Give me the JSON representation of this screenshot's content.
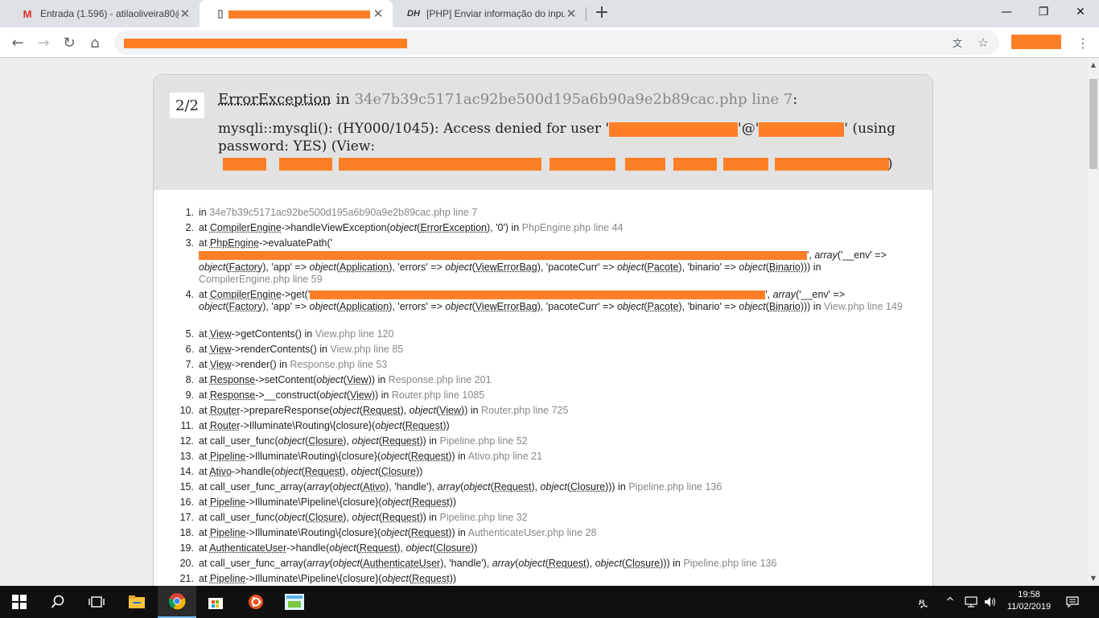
{
  "browser": {
    "tabs": [
      {
        "title": "Entrada (1.596) - atilaoliveira80@",
        "icon": "gmail-icon",
        "active": false
      },
      {
        "title": "",
        "icon": "page-icon",
        "active": true
      },
      {
        "title": "[PHP] Enviar informação do input",
        "icon": "dh-icon",
        "active": false
      }
    ],
    "new_tab_label": "+",
    "window_controls": {
      "minimize": "—",
      "maximize": "❐",
      "close": "✕"
    },
    "toolbar": {
      "back": "←",
      "forward": "→",
      "reload": "↻",
      "home": "⌂",
      "translate": "文",
      "bookmark": "☆"
    }
  },
  "error": {
    "count": "2/2",
    "exception": "ErrorException",
    "in_word": "in",
    "file": "34e7b39c5171ac92be500d195a6b90a9e2b89cac.php line 7",
    "colon": ":",
    "message_part1": "mysqli::mysqli(): (HY000/1045): Access denied for user '",
    "message_part2": "'@'",
    "message_part3": "' (using password: YES) (View:",
    "view_path_end": ")"
  },
  "trace": [
    {
      "n": "1.",
      "segments": [
        {
          "t": "in "
        },
        {
          "t": "34e7b39c5171ac92be500d195a6b90a9e2b89cac.php line 7",
          "c": "f"
        }
      ]
    },
    {
      "n": "2.",
      "segments": [
        {
          "t": "at "
        },
        {
          "t": "CompilerEngine",
          "c": "u"
        },
        {
          "t": "->handleViewException("
        },
        {
          "t": "object",
          "c": "i"
        },
        {
          "t": "("
        },
        {
          "t": "ErrorException",
          "c": "u"
        },
        {
          "t": "), '0') in "
        },
        {
          "t": "PhpEngine.php line 44",
          "c": "f"
        }
      ]
    },
    {
      "n": "3.",
      "segments": [
        {
          "t": "at "
        },
        {
          "t": "PhpEngine",
          "c": "u"
        },
        {
          "t": "->evaluatePath('"
        },
        {
          "t": "REDACT"
        },
        {
          "t": "', "
        },
        {
          "t": "array",
          "c": "i"
        },
        {
          "t": "('__env' => "
        },
        {
          "t": "object",
          "c": "i"
        },
        {
          "t": "("
        },
        {
          "t": "Factory",
          "c": "u"
        },
        {
          "t": "), 'app' => "
        },
        {
          "t": "object",
          "c": "i"
        },
        {
          "t": "("
        },
        {
          "t": "Application",
          "c": "u"
        },
        {
          "t": "), 'errors' => "
        },
        {
          "t": "object",
          "c": "i"
        },
        {
          "t": "("
        },
        {
          "t": "ViewErrorBag",
          "c": "u"
        },
        {
          "t": "), 'pacoteCurr' => "
        },
        {
          "t": "object",
          "c": "i"
        },
        {
          "t": "("
        },
        {
          "t": "Pacote",
          "c": "u"
        },
        {
          "t": "), 'binario' => "
        },
        {
          "t": "object",
          "c": "i"
        },
        {
          "t": "("
        },
        {
          "t": "Binario",
          "c": "u"
        },
        {
          "t": "))) in "
        },
        {
          "t": "CompilerEngine.php line 59",
          "c": "f"
        }
      ]
    },
    {
      "n": "4.",
      "segments": [
        {
          "t": "at "
        },
        {
          "t": "CompilerEngine",
          "c": "u"
        },
        {
          "t": "->get('"
        },
        {
          "t": "REDACT"
        },
        {
          "t": "', "
        },
        {
          "t": "array",
          "c": "i"
        },
        {
          "t": "('__env' => "
        },
        {
          "t": "object",
          "c": "i"
        },
        {
          "t": "("
        },
        {
          "t": "Factory",
          "c": "u"
        },
        {
          "t": "), 'app' => "
        },
        {
          "t": "object",
          "c": "i"
        },
        {
          "t": "("
        },
        {
          "t": "Application",
          "c": "u"
        },
        {
          "t": "), 'errors' => "
        },
        {
          "t": "object",
          "c": "i"
        },
        {
          "t": "("
        },
        {
          "t": "ViewErrorBag",
          "c": "u"
        },
        {
          "t": "), 'pacoteCurr' => "
        },
        {
          "t": "object",
          "c": "i"
        },
        {
          "t": "("
        },
        {
          "t": "Pacote",
          "c": "u"
        },
        {
          "t": "), 'binario' => "
        },
        {
          "t": "object",
          "c": "i"
        },
        {
          "t": "("
        },
        {
          "t": "Binario",
          "c": "u"
        },
        {
          "t": "))) in "
        },
        {
          "t": "View.php line 149",
          "c": "f"
        }
      ]
    },
    {
      "n": "5.",
      "segments": [
        {
          "t": "at "
        },
        {
          "t": "View",
          "c": "u"
        },
        {
          "t": "->getContents() in "
        },
        {
          "t": "View.php line 120",
          "c": "f"
        }
      ]
    },
    {
      "n": "6.",
      "segments": [
        {
          "t": "at "
        },
        {
          "t": "View",
          "c": "u"
        },
        {
          "t": "->renderContents() in "
        },
        {
          "t": "View.php line 85",
          "c": "f"
        }
      ]
    },
    {
      "n": "7.",
      "segments": [
        {
          "t": "at "
        },
        {
          "t": "View",
          "c": "u"
        },
        {
          "t": "->render() in "
        },
        {
          "t": "Response.php line 53",
          "c": "f"
        }
      ]
    },
    {
      "n": "8.",
      "segments": [
        {
          "t": "at "
        },
        {
          "t": "Response",
          "c": "u"
        },
        {
          "t": "->setContent("
        },
        {
          "t": "object",
          "c": "i"
        },
        {
          "t": "("
        },
        {
          "t": "View",
          "c": "u"
        },
        {
          "t": ")) in "
        },
        {
          "t": "Response.php line 201",
          "c": "f"
        }
      ]
    },
    {
      "n": "9.",
      "segments": [
        {
          "t": "at "
        },
        {
          "t": "Response",
          "c": "u"
        },
        {
          "t": "->__construct("
        },
        {
          "t": "object",
          "c": "i"
        },
        {
          "t": "("
        },
        {
          "t": "View",
          "c": "u"
        },
        {
          "t": ")) in "
        },
        {
          "t": "Router.php line 1085",
          "c": "f"
        }
      ]
    },
    {
      "n": "10.",
      "segments": [
        {
          "t": "at "
        },
        {
          "t": "Router",
          "c": "u"
        },
        {
          "t": "->prepareResponse("
        },
        {
          "t": "object",
          "c": "i"
        },
        {
          "t": "("
        },
        {
          "t": "Request",
          "c": "u"
        },
        {
          "t": "), "
        },
        {
          "t": "object",
          "c": "i"
        },
        {
          "t": "("
        },
        {
          "t": "View",
          "c": "u"
        },
        {
          "t": ")) in "
        },
        {
          "t": "Router.php line 725",
          "c": "f"
        }
      ]
    },
    {
      "n": "11.",
      "segments": [
        {
          "t": "at "
        },
        {
          "t": "Router",
          "c": "u"
        },
        {
          "t": "->Illuminate\\Routing\\{closure}("
        },
        {
          "t": "object",
          "c": "i"
        },
        {
          "t": "("
        },
        {
          "t": "Request",
          "c": "u"
        },
        {
          "t": "))"
        }
      ]
    },
    {
      "n": "12.",
      "segments": [
        {
          "t": "at call_user_func("
        },
        {
          "t": "object",
          "c": "i"
        },
        {
          "t": "("
        },
        {
          "t": "Closure",
          "c": "u"
        },
        {
          "t": "), "
        },
        {
          "t": "object",
          "c": "i"
        },
        {
          "t": "("
        },
        {
          "t": "Request",
          "c": "u"
        },
        {
          "t": ")) in "
        },
        {
          "t": "Pipeline.php line 52",
          "c": "f"
        }
      ]
    },
    {
      "n": "13.",
      "segments": [
        {
          "t": "at "
        },
        {
          "t": "Pipeline",
          "c": "u"
        },
        {
          "t": "->Illuminate\\Routing\\{closure}("
        },
        {
          "t": "object",
          "c": "i"
        },
        {
          "t": "("
        },
        {
          "t": "Request",
          "c": "u"
        },
        {
          "t": ")) in "
        },
        {
          "t": "Ativo.php line 21",
          "c": "f"
        }
      ]
    },
    {
      "n": "14.",
      "segments": [
        {
          "t": "at "
        },
        {
          "t": "Ativo",
          "c": "u"
        },
        {
          "t": "->handle("
        },
        {
          "t": "object",
          "c": "i"
        },
        {
          "t": "("
        },
        {
          "t": "Request",
          "c": "u"
        },
        {
          "t": "), "
        },
        {
          "t": "object",
          "c": "i"
        },
        {
          "t": "("
        },
        {
          "t": "Closure",
          "c": "u"
        },
        {
          "t": "))"
        }
      ]
    },
    {
      "n": "15.",
      "segments": [
        {
          "t": "at call_user_func_array("
        },
        {
          "t": "array",
          "c": "i"
        },
        {
          "t": "("
        },
        {
          "t": "object",
          "c": "i"
        },
        {
          "t": "("
        },
        {
          "t": "Ativo",
          "c": "u"
        },
        {
          "t": "), 'handle'), "
        },
        {
          "t": "array",
          "c": "i"
        },
        {
          "t": "("
        },
        {
          "t": "object",
          "c": "i"
        },
        {
          "t": "("
        },
        {
          "t": "Request",
          "c": "u"
        },
        {
          "t": "), "
        },
        {
          "t": "object",
          "c": "i"
        },
        {
          "t": "("
        },
        {
          "t": "Closure",
          "c": "u"
        },
        {
          "t": "))) in "
        },
        {
          "t": "Pipeline.php line 136",
          "c": "f"
        }
      ]
    },
    {
      "n": "16.",
      "segments": [
        {
          "t": "at "
        },
        {
          "t": "Pipeline",
          "c": "u"
        },
        {
          "t": "->Illuminate\\Pipeline\\{closure}("
        },
        {
          "t": "object",
          "c": "i"
        },
        {
          "t": "("
        },
        {
          "t": "Request",
          "c": "u"
        },
        {
          "t": "))"
        }
      ]
    },
    {
      "n": "17.",
      "segments": [
        {
          "t": "at call_user_func("
        },
        {
          "t": "object",
          "c": "i"
        },
        {
          "t": "("
        },
        {
          "t": "Closure",
          "c": "u"
        },
        {
          "t": "), "
        },
        {
          "t": "object",
          "c": "i"
        },
        {
          "t": "("
        },
        {
          "t": "Request",
          "c": "u"
        },
        {
          "t": ")) in "
        },
        {
          "t": "Pipeline.php line 32",
          "c": "f"
        }
      ]
    },
    {
      "n": "18.",
      "segments": [
        {
          "t": "at "
        },
        {
          "t": "Pipeline",
          "c": "u"
        },
        {
          "t": "->Illuminate\\Routing\\{closure}("
        },
        {
          "t": "object",
          "c": "i"
        },
        {
          "t": "("
        },
        {
          "t": "Request",
          "c": "u"
        },
        {
          "t": ")) in "
        },
        {
          "t": "AuthenticateUser.php line 28",
          "c": "f"
        }
      ]
    },
    {
      "n": "19.",
      "segments": [
        {
          "t": "at "
        },
        {
          "t": "AuthenticateUser",
          "c": "u"
        },
        {
          "t": "->handle("
        },
        {
          "t": "object",
          "c": "i"
        },
        {
          "t": "("
        },
        {
          "t": "Request",
          "c": "u"
        },
        {
          "t": "), "
        },
        {
          "t": "object",
          "c": "i"
        },
        {
          "t": "("
        },
        {
          "t": "Closure",
          "c": "u"
        },
        {
          "t": "))"
        }
      ]
    },
    {
      "n": "20.",
      "segments": [
        {
          "t": "at call_user_func_array("
        },
        {
          "t": "array",
          "c": "i"
        },
        {
          "t": "("
        },
        {
          "t": "object",
          "c": "i"
        },
        {
          "t": "("
        },
        {
          "t": "AuthenticateUser",
          "c": "u"
        },
        {
          "t": "), 'handle'), "
        },
        {
          "t": "array",
          "c": "i"
        },
        {
          "t": "("
        },
        {
          "t": "object",
          "c": "i"
        },
        {
          "t": "("
        },
        {
          "t": "Request",
          "c": "u"
        },
        {
          "t": "), "
        },
        {
          "t": "object",
          "c": "i"
        },
        {
          "t": "("
        },
        {
          "t": "Closure",
          "c": "u"
        },
        {
          "t": "))) in "
        },
        {
          "t": "Pipeline.php line 136",
          "c": "f"
        }
      ]
    },
    {
      "n": "21.",
      "segments": [
        {
          "t": "at "
        },
        {
          "t": "Pipeline",
          "c": "u"
        },
        {
          "t": "->Illuminate\\Pipeline\\{closure}("
        },
        {
          "t": "object",
          "c": "i"
        },
        {
          "t": "("
        },
        {
          "t": "Request",
          "c": "u"
        },
        {
          "t": "))"
        }
      ]
    }
  ],
  "taskbar": {
    "clock_time": "19:58",
    "clock_date": "11/02/2019",
    "items": [
      "windows-start-icon",
      "search-icon",
      "task-view-icon",
      "file-explorer-icon",
      "chrome-icon",
      "store-icon",
      "ubuntu-icon",
      "php-app-icon"
    ]
  },
  "colors": {
    "accent": "#ff7f27",
    "file_grey": "#888888",
    "header_bg": "#e2e2e2"
  }
}
